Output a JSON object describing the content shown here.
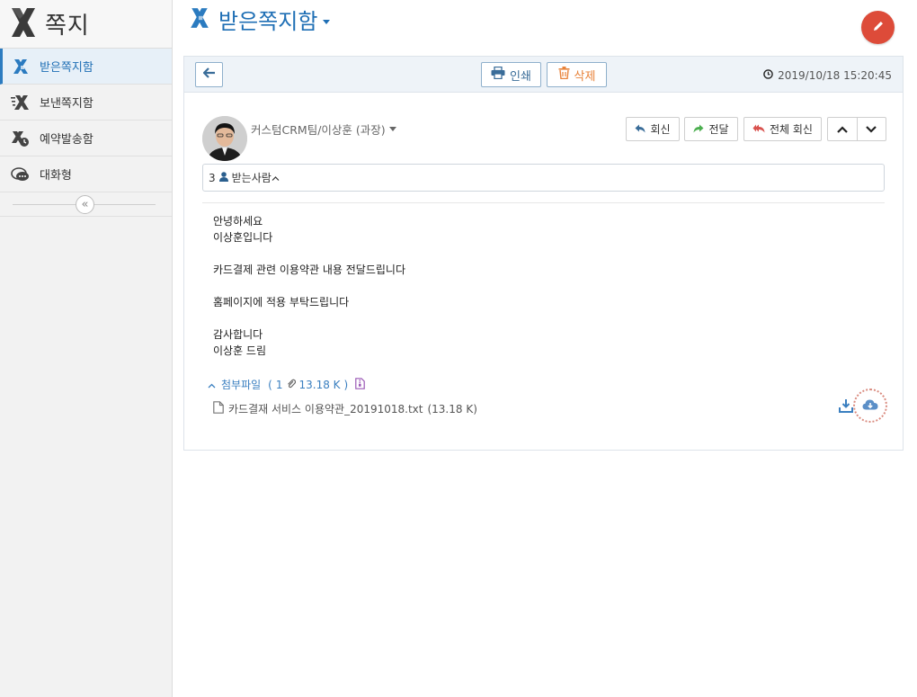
{
  "app": {
    "title": "쪽지"
  },
  "sidebar": {
    "items": [
      {
        "label": "받은쪽지함",
        "icon": "inbox-icon",
        "active": true
      },
      {
        "label": "보낸쪽지함",
        "icon": "sent-icon",
        "active": false
      },
      {
        "label": "예약발송함",
        "icon": "scheduled-icon",
        "active": false
      },
      {
        "label": "대화형",
        "icon": "chat-icon",
        "active": false
      }
    ],
    "collapse_icon": "double-chevron-left-icon"
  },
  "header": {
    "title": "받은쪽지함",
    "compose_icon": "pencil-icon"
  },
  "toolbar": {
    "back_icon": "arrow-left-icon",
    "print_label": "인쇄",
    "delete_label": "삭제",
    "datetime": "2019/10/18 15:20:45"
  },
  "message": {
    "sender": "커스텀CRM팀/이상훈 (과장)",
    "actions": {
      "reply": "회신",
      "forward": "전달",
      "reply_all": "전체 회신"
    },
    "recipients": {
      "count": "3",
      "label": "받는사람"
    },
    "body": "안녕하세요\n이상훈입니다\n\n카드결제 관련 이용약관 내용 전달드립니다\n\n홈페이지에 적용 부탁드립니다\n\n감사합니다\n이상훈 드림",
    "attachments": {
      "label": "첨부파일",
      "count": "1",
      "total_size": "13.18 K",
      "files": [
        {
          "name": "카드결재 서비스 이용약관_20191018.txt",
          "size": "(13.18 K)"
        }
      ]
    }
  },
  "colors": {
    "accent": "#1f6fb5",
    "danger": "#dd4b39",
    "delete": "#e8833a",
    "forward": "#4caf50",
    "reply_all": "#d9534f"
  }
}
